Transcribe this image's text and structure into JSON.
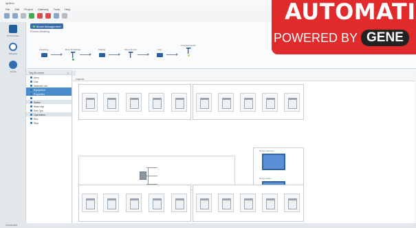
{
  "window": {
    "title": "Ignition"
  },
  "menu": [
    "File",
    "Edit",
    "Project",
    "Gateway",
    "Tools",
    "Help"
  ],
  "nav": [
    {
      "label": "Performance",
      "icon": "chart-icon"
    },
    {
      "label": "Schedule",
      "icon": "clock-icon"
    },
    {
      "label": "Trends",
      "icon": "gauge-icon"
    }
  ],
  "flow": {
    "tab": "Model Management",
    "subtitle": "Process Modeling",
    "steps": [
      "Receiving",
      "Move To Storage",
      "Staging",
      "Move To Line",
      "Line",
      "Finished Goods"
    ]
  },
  "sidebar": {
    "title": "Tag Browser",
    "rows": [
      {
        "label": "Area",
        "style": ""
      },
      {
        "label": "Line",
        "style": ""
      },
      {
        "label": "Material Lots",
        "style": ""
      },
      {
        "label": "Equipment",
        "style": "hl"
      },
      {
        "label": "Properties",
        "style": "hl"
      },
      {
        "label": "",
        "style": ""
      },
      {
        "label": "Status",
        "style": "head"
      },
      {
        "label": "State Mgr",
        "style": ""
      },
      {
        "label": "Sub Ops",
        "style": ""
      },
      {
        "label": "Operations",
        "style": "head"
      },
      {
        "label": "Run",
        "style": ""
      },
      {
        "label": "Stop",
        "style": ""
      }
    ]
  },
  "properties_label": "Properties",
  "canvas_tab": "Layout",
  "right_group_labels": [
    "Recipe Manager",
    "Recipe Editor"
  ],
  "status": "Connected",
  "banner": {
    "title": "AUTOMATI",
    "powered": "POWERED BY",
    "brand": "GENE"
  },
  "colors": {
    "accent": "#e02a2b",
    "brand_blue": "#2f6fb2"
  }
}
